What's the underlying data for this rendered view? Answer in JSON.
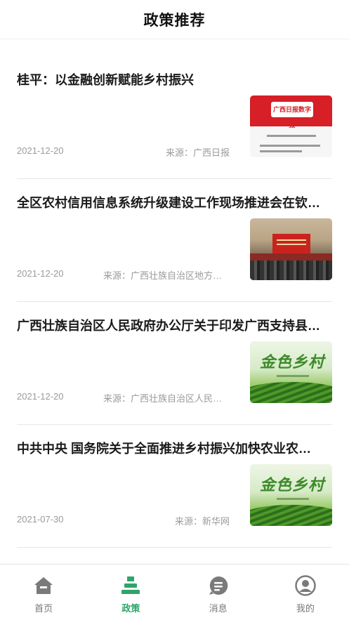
{
  "header": {
    "title": "政策推荐"
  },
  "articles": [
    {
      "title": "桂平：以金融创新赋能乡村振兴",
      "date": "2021-12-20",
      "source": "来源：广西日报",
      "thumb_icon": "newspaper-thumb",
      "thumb_text": "广西日报数字报"
    },
    {
      "title": "全区农村信用信息系统升级建设工作现场推进会在钦…",
      "date": "2021-12-20",
      "source": "来源：广西壮族自治区地方金…",
      "thumb_icon": "meeting-photo-thumb"
    },
    {
      "title": "广西壮族自治区人民政府办公厅关于印发广西支持县…",
      "date": "2021-12-20",
      "source": "来源：广西壮族自治区人民政…",
      "thumb_icon": "green-banner-thumb",
      "thumb_text": "金色乡村"
    },
    {
      "title": "中共中央 国务院关于全面推进乡村振兴加快农业农…",
      "date": "2021-07-30",
      "source": "来源：新华网",
      "thumb_icon": "green-banner-thumb",
      "thumb_text": "金色乡村"
    }
  ],
  "tabs": [
    {
      "label": "首页",
      "icon": "home-icon",
      "active": false
    },
    {
      "label": "政策",
      "icon": "policy-icon",
      "active": true
    },
    {
      "label": "消息",
      "icon": "message-icon",
      "active": false
    },
    {
      "label": "我的",
      "icon": "profile-icon",
      "active": false
    }
  ],
  "colors": {
    "accent": "#2fa46b",
    "inactive": "#777777",
    "meta": "#9a9a9a"
  }
}
